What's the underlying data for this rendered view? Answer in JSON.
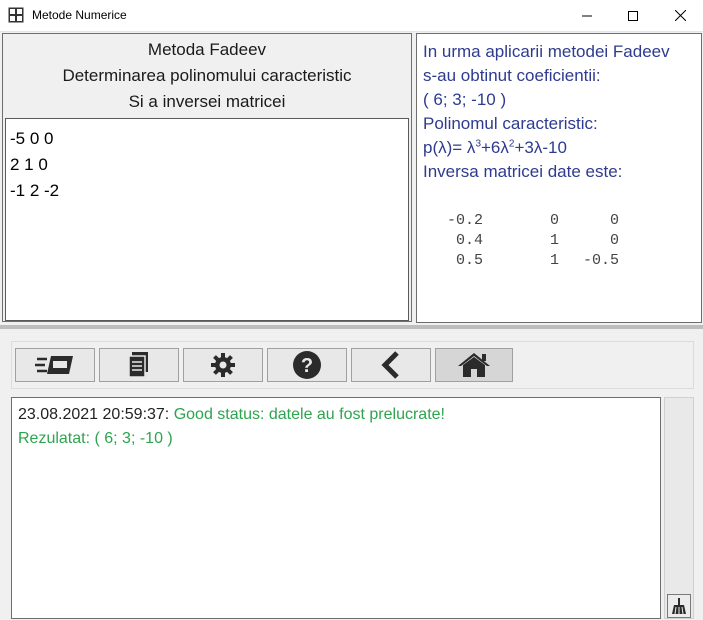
{
  "window": {
    "title": "Metode Numerice"
  },
  "left": {
    "heading": [
      "Metoda Fadeev",
      "Determinarea polinomului caracteristic",
      "Si a inversei matricei"
    ],
    "matrix_lines": [
      "-5 0 0",
      "2 1 0",
      "-1 2 -2"
    ]
  },
  "right": {
    "line1": "In urma aplicarii metodei Fadeev",
    "line2": "s-au obtinut coeficientii:",
    "coefficients": "( 6; 3; -10 )",
    "poly_label": "Polinomul caracteristic:",
    "poly": {
      "p": "p(λ)= λ",
      "e1": "3",
      "m": "+6λ",
      "e2": "2",
      "tail": "+3λ-10"
    },
    "inverse_label": "Inversa matricei date este:",
    "inverse": [
      [
        "-0.2",
        "0",
        "0"
      ],
      [
        "0.4",
        "1",
        "0"
      ],
      [
        "0.5",
        "1",
        "-0.5"
      ]
    ]
  },
  "toolbar": {
    "buttons": [
      {
        "icon": "input-form-icon"
      },
      {
        "icon": "document-icon"
      },
      {
        "icon": "gear-icon"
      },
      {
        "icon": "help-icon"
      },
      {
        "icon": "back-chevron-icon"
      },
      {
        "icon": "home-icon"
      }
    ]
  },
  "log": {
    "timestamp": "23.08.2021 20:59:37: ",
    "status": "Good status: datele au fost prelucrate!",
    "result": "Rezulatat: ( 6; 3; -10 )"
  },
  "colors": {
    "status_green": "#2ea44f",
    "text_blue": "#2e3b8f"
  }
}
